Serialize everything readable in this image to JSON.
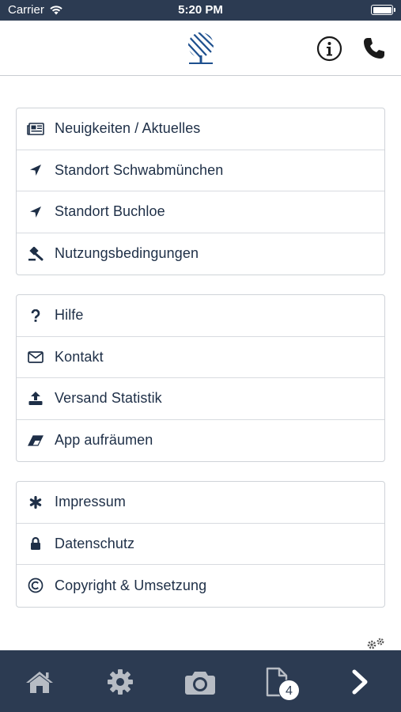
{
  "status_bar": {
    "carrier": "Carrier",
    "time": "5:20 PM"
  },
  "groups": [
    {
      "items": [
        {
          "icon": "newspaper-icon",
          "label": "Neuigkeiten / Aktuelles"
        },
        {
          "icon": "location-arrow-icon",
          "label": "Standort Schwabmünchen"
        },
        {
          "icon": "location-arrow-icon",
          "label": "Standort Buchloe"
        },
        {
          "icon": "gavel-icon",
          "label": "Nutzungsbedingungen"
        }
      ]
    },
    {
      "items": [
        {
          "icon": "question-icon",
          "label": "Hilfe"
        },
        {
          "icon": "envelope-icon",
          "label": "Kontakt"
        },
        {
          "icon": "upload-icon",
          "label": "Versand Statistik"
        },
        {
          "icon": "eraser-icon",
          "label": "App aufräumen"
        }
      ]
    },
    {
      "items": [
        {
          "icon": "asterisk-icon",
          "label": "Impressum"
        },
        {
          "icon": "lock-icon",
          "label": "Datenschutz"
        },
        {
          "icon": "copyright-icon",
          "label": "Copyright & Umsetzung"
        }
      ]
    }
  ],
  "tab_bar": {
    "tabs": [
      "home-icon",
      "settings-icon",
      "camera-icon",
      "document-icon",
      "chevron-right-icon"
    ],
    "document_badge": "4"
  },
  "colors": {
    "navy": "#2c3b52",
    "text": "#1e2f47",
    "logo_blue": "#1d4f8e"
  }
}
